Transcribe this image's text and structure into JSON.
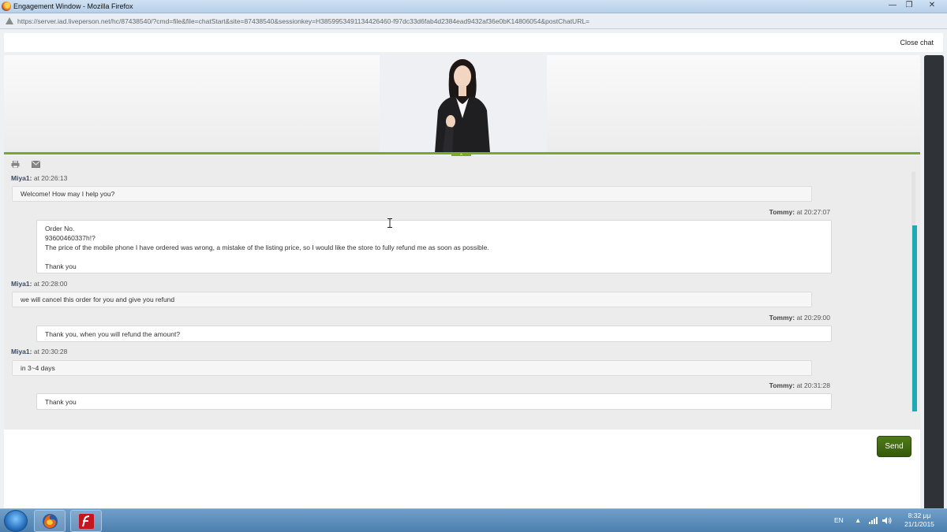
{
  "window": {
    "title": "Engagement Window - Mozilla Firefox",
    "min_glyph": "—",
    "max_glyph": "❐",
    "close_glyph": "✕"
  },
  "urlbar": {
    "url": "https://server.iad.liveperson.net/hc/87438540/?cmd=file&file=chatStart&site=87438540&sessionkey=H385995349113442646​0-f97dc33d6fab4d2384ead9432af36e0bK14806054&postChatURL="
  },
  "topbar": {
    "close_label": "Close chat"
  },
  "banner": {
    "collapse_glyph": "⌃"
  },
  "messages": [
    {
      "sender": "Miya1:",
      "time": "at 20:26:13",
      "side": "agent",
      "lines": [
        "Welcome! How may I help you?"
      ]
    },
    {
      "sender": "Tommy:",
      "time": "at 20:27:07",
      "side": "user",
      "lines": [
        "Order No.",
        "93600460337h!?",
        "The price of the mobile phone I have ordered was wrong, a mistake of the listing price, so I would like the store to fully refund me as soon as possible.",
        "",
        "Thank you"
      ]
    },
    {
      "sender": "Miya1:",
      "time": "at 20:28:00",
      "side": "agent",
      "lines": [
        "we will cancel this order for you and give you refund"
      ]
    },
    {
      "sender": "Tommy:",
      "time": "at 20:29:00",
      "side": "user",
      "lines": [
        "Thank you, when you will refund the amount?"
      ]
    },
    {
      "sender": "Miya1:",
      "time": "at 20:30:28",
      "side": "agent",
      "lines": [
        "in 3~4 days"
      ]
    },
    {
      "sender": "Tommy:",
      "time": "at 20:31:28",
      "side": "user",
      "lines": [
        "Thank you"
      ]
    }
  ],
  "input": {
    "send_label": "Send"
  },
  "taskbar": {
    "language": "EN",
    "clock_time": "8:32 μμ",
    "clock_date": "21/1/2015"
  },
  "colors": {
    "accent_green": "#7ba829",
    "scroll_teal": "#1fa9b4",
    "send_green": "#4f7a19"
  }
}
